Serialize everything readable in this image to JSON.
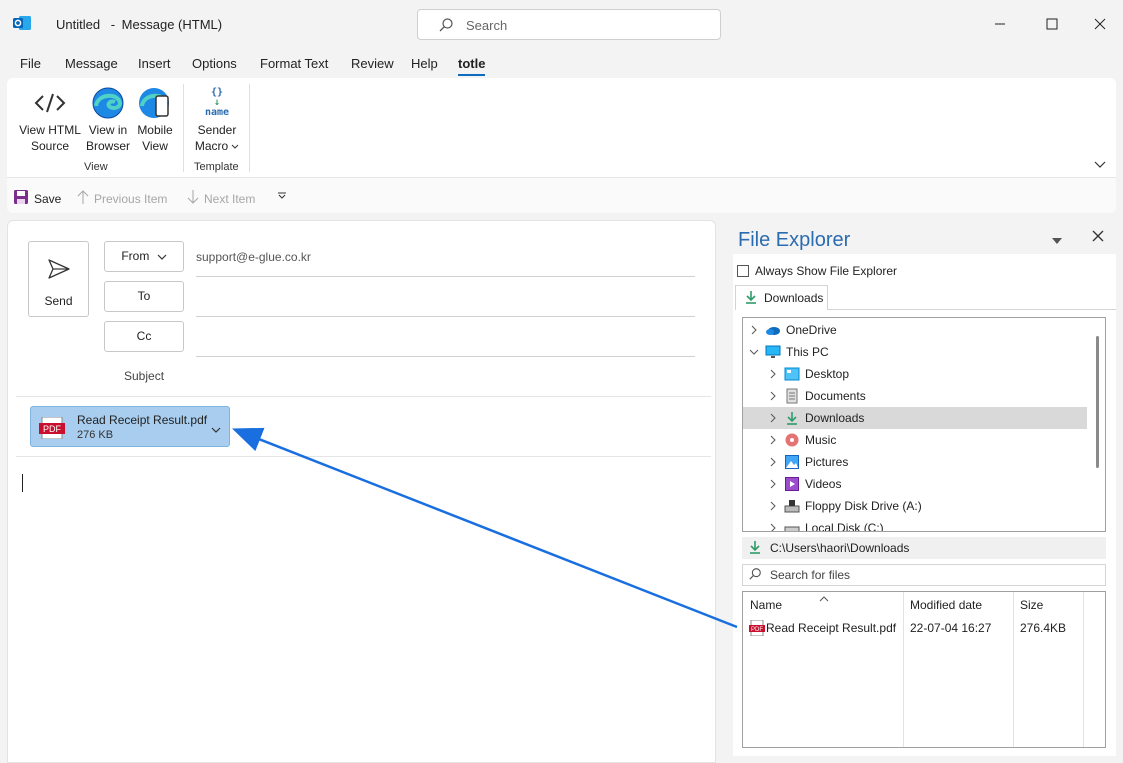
{
  "window": {
    "title": "Untitled",
    "subtitle": "Message (HTML)",
    "search_placeholder": "Search"
  },
  "menu": [
    "File",
    "Message",
    "Insert",
    "Options",
    "Format Text",
    "Review",
    "Help",
    "totle"
  ],
  "ribbon": {
    "view_html_source": [
      "View HTML",
      "Source"
    ],
    "view_in_browser": [
      "View in",
      "Browser"
    ],
    "mobile_view": [
      "Mobile",
      "View"
    ],
    "sender_macro": [
      "Sender",
      "Macro"
    ],
    "macro_icon_text": "name",
    "group_view": "View",
    "group_template": "Template"
  },
  "qat": {
    "save": "Save",
    "previous_item": "Previous Item",
    "next_item": "Next Item"
  },
  "compose": {
    "send_label": "Send",
    "from_label": "From",
    "from_value": "support@e-glue.co.kr",
    "to_label": "To",
    "cc_label": "Cc",
    "subject_label": "Subject",
    "attachment": {
      "name": "Read Receipt Result.pdf",
      "size": "276 KB",
      "icon_text": "PDF"
    }
  },
  "file_explorer": {
    "title": "File Explorer",
    "always_show": "Always Show File Explorer",
    "tab": "Downloads",
    "tree": [
      {
        "label": "OneDrive",
        "expanded": false
      },
      {
        "label": "This PC",
        "expanded": true
      },
      {
        "label": "Desktop"
      },
      {
        "label": "Documents"
      },
      {
        "label": "Downloads",
        "selected": true
      },
      {
        "label": "Music"
      },
      {
        "label": "Pictures"
      },
      {
        "label": "Videos"
      },
      {
        "label": "Floppy Disk Drive (A:)"
      },
      {
        "label": "Local Disk (C:)"
      }
    ],
    "path": "C:\\Users\\haori\\Downloads",
    "search_placeholder": "Search for files",
    "columns": [
      "Name",
      "Modified date",
      "Size"
    ],
    "files": [
      {
        "name": "Read Receipt Result.pdf",
        "modified": "22-07-04 16:27",
        "size": "276.4KB"
      }
    ]
  },
  "colors": {
    "accent": "#0f6cbd",
    "attachment_bg": "#a8cdee",
    "arrow": "#1a6fe0",
    "fe_title": "#2b6cb0"
  }
}
